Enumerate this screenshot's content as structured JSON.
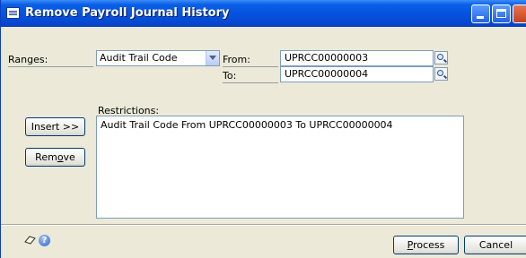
{
  "window": {
    "title": "Remove Payroll Journal History"
  },
  "ranges": {
    "label": "Ranges:",
    "selected": "Audit Trail Code",
    "from_label": "From:",
    "from_value": "UPRCC00000003",
    "to_label": "To:",
    "to_value": "UPRCC00000004"
  },
  "restrictions": {
    "label": "Restrictions:",
    "items": [
      "Audit Trail Code From UPRCC00000003 To UPRCC00000004"
    ]
  },
  "buttons": {
    "insert": "Insert >>",
    "remove_pre": "Rem",
    "remove_hotkey": "o",
    "remove_post": "ve",
    "process_hotkey": "P",
    "process_post": "rocess",
    "cancel": "Cancel"
  },
  "footer": {
    "help_glyph": "?"
  },
  "icons": [
    "window-icon",
    "dropdown-arrow-icon",
    "lookup-icon",
    "note-icon",
    "help-icon"
  ]
}
